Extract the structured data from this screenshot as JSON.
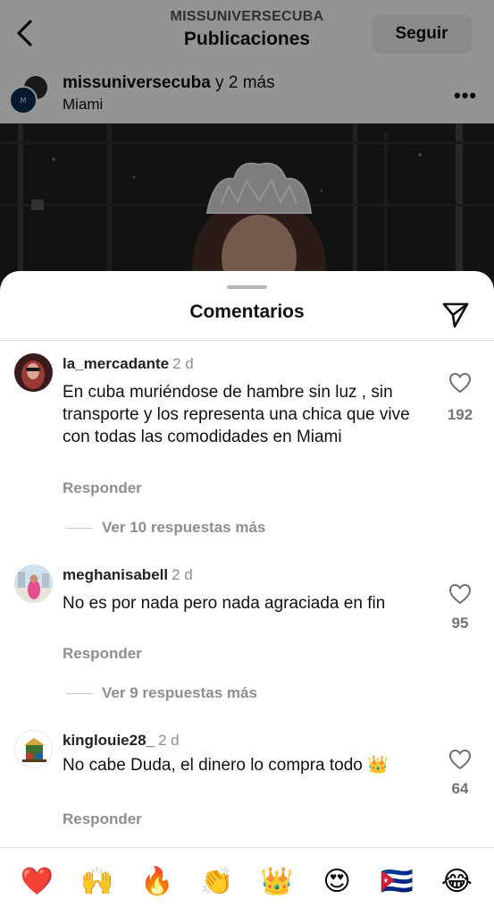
{
  "header": {
    "account": "MISSUNIVERSECUBA",
    "title": "Publicaciones",
    "follow_label": "Seguir"
  },
  "post": {
    "author_user": "missuniversecuba",
    "author_more": "y 2 más",
    "location": "Miami",
    "more_icon": "•••"
  },
  "sheet": {
    "title": "Comentarios"
  },
  "comments": [
    {
      "user": "la_mercadante",
      "time": "2 d",
      "text": "En cuba muriéndose de hambre sin luz , sin transporte y los representa una chica que vive con todas las comodidades en Miami",
      "reply_label": "Responder",
      "likes": "192",
      "more_replies": "Ver 10 respuestas más"
    },
    {
      "user": "meghanisabell",
      "time": "2 d",
      "text": "No es por nada pero nada agraciada en fin",
      "reply_label": "Responder",
      "likes": "95",
      "more_replies": "Ver 9 respuestas más"
    },
    {
      "user": "kinglouie28_",
      "time": "2 d",
      "text": "No cabe Duda, el dinero lo compra todo 👑",
      "reply_label": "Responder",
      "likes": "64"
    }
  ],
  "emoji_bar": [
    "❤️",
    "🙌",
    "🔥",
    "👏",
    "👑",
    "😍",
    "🇨🇺",
    "😂"
  ],
  "colors": {
    "secondary_text": "#8e8e8e",
    "follow_button_bg": "#efefef",
    "overlay": "rgba(0,0,0,0.42)"
  }
}
